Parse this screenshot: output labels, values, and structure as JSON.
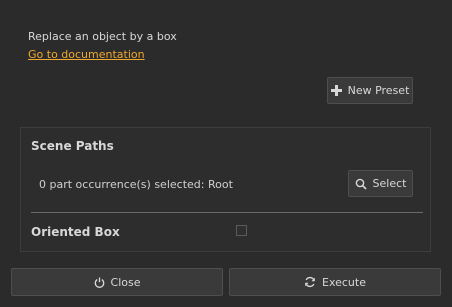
{
  "description": "Replace an object by a box",
  "doc_link": "Go to documentation",
  "preset_button": {
    "label": "New Preset",
    "icon": "plus-icon"
  },
  "scene_paths": {
    "title": "Scene Paths",
    "selection_text": "0 part occurrence(s) selected: Root",
    "select_button": {
      "label": "Select",
      "icon": "magnifier-icon"
    }
  },
  "oriented_box": {
    "label": "Oriented Box",
    "checked": false
  },
  "footer": {
    "close_label": "Close",
    "execute_label": "Execute"
  },
  "colors": {
    "background": "#2b2b2b",
    "link": "#f0a830",
    "button": "#3a3a3a"
  }
}
